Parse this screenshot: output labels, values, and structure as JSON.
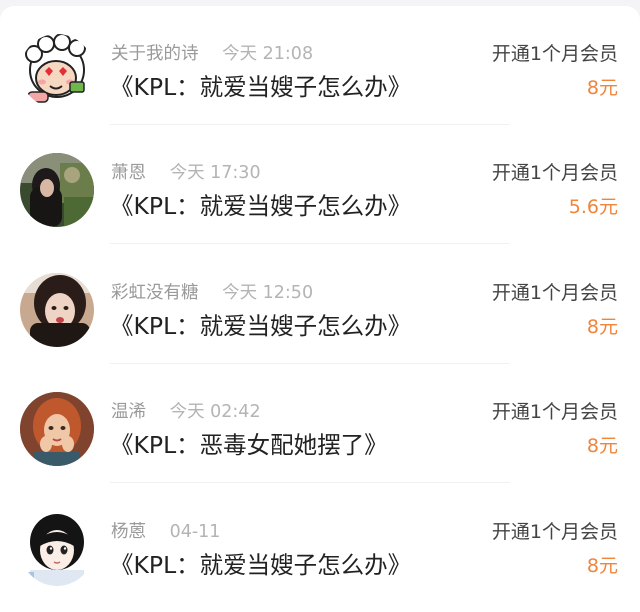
{
  "orders": [
    {
      "name": "关于我的诗",
      "time": "今天 21:08",
      "title": "《KPL：就爱当嫂子怎么办》",
      "plan": "开通1个月会员",
      "price": "8元",
      "avatar": "cartoon-sheep-avatar"
    },
    {
      "name": "萧恩",
      "time": "今天 17:30",
      "title": "《KPL：就爱当嫂子怎么办》",
      "plan": "开通1个月会员",
      "price": "5.6元",
      "avatar": "girl-photo-avatar"
    },
    {
      "name": "彩虹没有糖",
      "time": "今天 12:50",
      "title": "《KPL：就爱当嫂子怎么办》",
      "plan": "开通1个月会员",
      "price": "8元",
      "avatar": "girl-selfie-avatar"
    },
    {
      "name": "温浠",
      "time": "今天 02:42",
      "title": "《KPL：恶毒女配她摆了》",
      "plan": "开通1个月会员",
      "price": "8元",
      "avatar": "painted-girl-avatar"
    },
    {
      "name": "杨蒽",
      "time": "04-11",
      "title": "《KPL：就爱当嫂子怎么办》",
      "plan": "开通1个月会员",
      "price": "8元",
      "avatar": "anime-girl-avatar"
    }
  ],
  "colors": {
    "price": "#f0843a",
    "secondary_text": "#9a9a9a",
    "primary_text": "#222222"
  }
}
